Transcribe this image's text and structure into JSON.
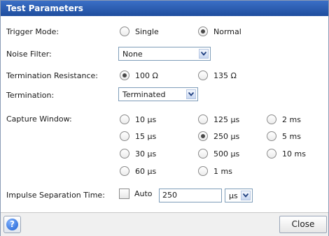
{
  "dialog": {
    "title": "Test Parameters"
  },
  "trigger_mode": {
    "label": "Trigger Mode:",
    "options": [
      "Single",
      "Normal"
    ],
    "selected": "Normal"
  },
  "noise_filter": {
    "label": "Noise Filter:",
    "value": "None"
  },
  "termination_resistance": {
    "label": "Termination Resistance:",
    "options": [
      "100 Ω",
      "135 Ω"
    ],
    "selected": "100 Ω"
  },
  "termination": {
    "label": "Termination:",
    "value": "Terminated"
  },
  "capture_window": {
    "label": "Capture Window:",
    "options": [
      "10 µs",
      "125 µs",
      "2 ms",
      "15 µs",
      "250 µs",
      "5 ms",
      "30 µs",
      "500 µs",
      "10 ms",
      "60 µs",
      "1 ms"
    ],
    "selected": "250 µs"
  },
  "impulse_separation": {
    "label": "Impulse Separation Time:",
    "auto_label": "Auto",
    "auto_checked": false,
    "value": "250",
    "unit": "µs"
  },
  "footer": {
    "close_label": "Close",
    "help_glyph": "?"
  },
  "icons": {
    "help": "help-icon",
    "dropdown": "chevron-down-icon"
  }
}
